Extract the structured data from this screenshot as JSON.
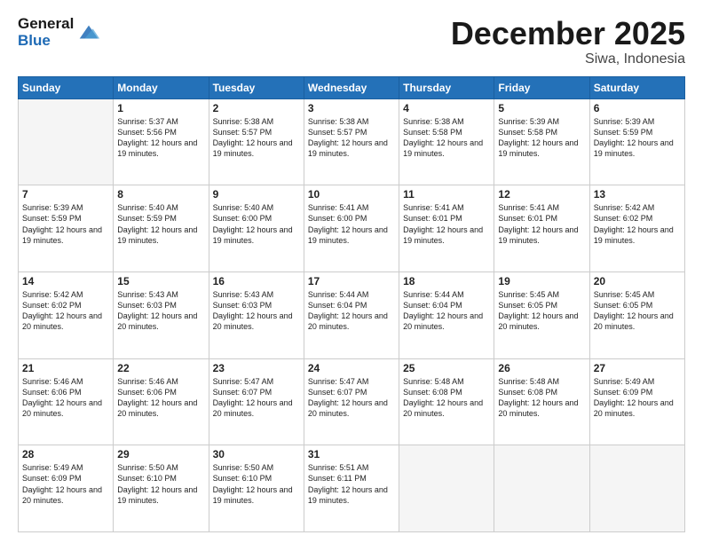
{
  "header": {
    "logo_line1": "General",
    "logo_line2": "Blue",
    "month": "December 2025",
    "location": "Siwa, Indonesia"
  },
  "days_of_week": [
    "Sunday",
    "Monday",
    "Tuesday",
    "Wednesday",
    "Thursday",
    "Friday",
    "Saturday"
  ],
  "weeks": [
    [
      {
        "day": "",
        "sunrise": "",
        "sunset": "",
        "daylight": "",
        "empty": true
      },
      {
        "day": "1",
        "sunrise": "Sunrise: 5:37 AM",
        "sunset": "Sunset: 5:56 PM",
        "daylight": "Daylight: 12 hours and 19 minutes."
      },
      {
        "day": "2",
        "sunrise": "Sunrise: 5:38 AM",
        "sunset": "Sunset: 5:57 PM",
        "daylight": "Daylight: 12 hours and 19 minutes."
      },
      {
        "day": "3",
        "sunrise": "Sunrise: 5:38 AM",
        "sunset": "Sunset: 5:57 PM",
        "daylight": "Daylight: 12 hours and 19 minutes."
      },
      {
        "day": "4",
        "sunrise": "Sunrise: 5:38 AM",
        "sunset": "Sunset: 5:58 PM",
        "daylight": "Daylight: 12 hours and 19 minutes."
      },
      {
        "day": "5",
        "sunrise": "Sunrise: 5:39 AM",
        "sunset": "Sunset: 5:58 PM",
        "daylight": "Daylight: 12 hours and 19 minutes."
      },
      {
        "day": "6",
        "sunrise": "Sunrise: 5:39 AM",
        "sunset": "Sunset: 5:59 PM",
        "daylight": "Daylight: 12 hours and 19 minutes."
      }
    ],
    [
      {
        "day": "7",
        "sunrise": "Sunrise: 5:39 AM",
        "sunset": "Sunset: 5:59 PM",
        "daylight": "Daylight: 12 hours and 19 minutes."
      },
      {
        "day": "8",
        "sunrise": "Sunrise: 5:40 AM",
        "sunset": "Sunset: 5:59 PM",
        "daylight": "Daylight: 12 hours and 19 minutes."
      },
      {
        "day": "9",
        "sunrise": "Sunrise: 5:40 AM",
        "sunset": "Sunset: 6:00 PM",
        "daylight": "Daylight: 12 hours and 19 minutes."
      },
      {
        "day": "10",
        "sunrise": "Sunrise: 5:41 AM",
        "sunset": "Sunset: 6:00 PM",
        "daylight": "Daylight: 12 hours and 19 minutes."
      },
      {
        "day": "11",
        "sunrise": "Sunrise: 5:41 AM",
        "sunset": "Sunset: 6:01 PM",
        "daylight": "Daylight: 12 hours and 19 minutes."
      },
      {
        "day": "12",
        "sunrise": "Sunrise: 5:41 AM",
        "sunset": "Sunset: 6:01 PM",
        "daylight": "Daylight: 12 hours and 19 minutes."
      },
      {
        "day": "13",
        "sunrise": "Sunrise: 5:42 AM",
        "sunset": "Sunset: 6:02 PM",
        "daylight": "Daylight: 12 hours and 19 minutes."
      }
    ],
    [
      {
        "day": "14",
        "sunrise": "Sunrise: 5:42 AM",
        "sunset": "Sunset: 6:02 PM",
        "daylight": "Daylight: 12 hours and 20 minutes."
      },
      {
        "day": "15",
        "sunrise": "Sunrise: 5:43 AM",
        "sunset": "Sunset: 6:03 PM",
        "daylight": "Daylight: 12 hours and 20 minutes."
      },
      {
        "day": "16",
        "sunrise": "Sunrise: 5:43 AM",
        "sunset": "Sunset: 6:03 PM",
        "daylight": "Daylight: 12 hours and 20 minutes."
      },
      {
        "day": "17",
        "sunrise": "Sunrise: 5:44 AM",
        "sunset": "Sunset: 6:04 PM",
        "daylight": "Daylight: 12 hours and 20 minutes."
      },
      {
        "day": "18",
        "sunrise": "Sunrise: 5:44 AM",
        "sunset": "Sunset: 6:04 PM",
        "daylight": "Daylight: 12 hours and 20 minutes."
      },
      {
        "day": "19",
        "sunrise": "Sunrise: 5:45 AM",
        "sunset": "Sunset: 6:05 PM",
        "daylight": "Daylight: 12 hours and 20 minutes."
      },
      {
        "day": "20",
        "sunrise": "Sunrise: 5:45 AM",
        "sunset": "Sunset: 6:05 PM",
        "daylight": "Daylight: 12 hours and 20 minutes."
      }
    ],
    [
      {
        "day": "21",
        "sunrise": "Sunrise: 5:46 AM",
        "sunset": "Sunset: 6:06 PM",
        "daylight": "Daylight: 12 hours and 20 minutes."
      },
      {
        "day": "22",
        "sunrise": "Sunrise: 5:46 AM",
        "sunset": "Sunset: 6:06 PM",
        "daylight": "Daylight: 12 hours and 20 minutes."
      },
      {
        "day": "23",
        "sunrise": "Sunrise: 5:47 AM",
        "sunset": "Sunset: 6:07 PM",
        "daylight": "Daylight: 12 hours and 20 minutes."
      },
      {
        "day": "24",
        "sunrise": "Sunrise: 5:47 AM",
        "sunset": "Sunset: 6:07 PM",
        "daylight": "Daylight: 12 hours and 20 minutes."
      },
      {
        "day": "25",
        "sunrise": "Sunrise: 5:48 AM",
        "sunset": "Sunset: 6:08 PM",
        "daylight": "Daylight: 12 hours and 20 minutes."
      },
      {
        "day": "26",
        "sunrise": "Sunrise: 5:48 AM",
        "sunset": "Sunset: 6:08 PM",
        "daylight": "Daylight: 12 hours and 20 minutes."
      },
      {
        "day": "27",
        "sunrise": "Sunrise: 5:49 AM",
        "sunset": "Sunset: 6:09 PM",
        "daylight": "Daylight: 12 hours and 20 minutes."
      }
    ],
    [
      {
        "day": "28",
        "sunrise": "Sunrise: 5:49 AM",
        "sunset": "Sunset: 6:09 PM",
        "daylight": "Daylight: 12 hours and 20 minutes."
      },
      {
        "day": "29",
        "sunrise": "Sunrise: 5:50 AM",
        "sunset": "Sunset: 6:10 PM",
        "daylight": "Daylight: 12 hours and 19 minutes."
      },
      {
        "day": "30",
        "sunrise": "Sunrise: 5:50 AM",
        "sunset": "Sunset: 6:10 PM",
        "daylight": "Daylight: 12 hours and 19 minutes."
      },
      {
        "day": "31",
        "sunrise": "Sunrise: 5:51 AM",
        "sunset": "Sunset: 6:11 PM",
        "daylight": "Daylight: 12 hours and 19 minutes."
      },
      {
        "day": "",
        "sunrise": "",
        "sunset": "",
        "daylight": "",
        "empty": true
      },
      {
        "day": "",
        "sunrise": "",
        "sunset": "",
        "daylight": "",
        "empty": true
      },
      {
        "day": "",
        "sunrise": "",
        "sunset": "",
        "daylight": "",
        "empty": true
      }
    ]
  ]
}
